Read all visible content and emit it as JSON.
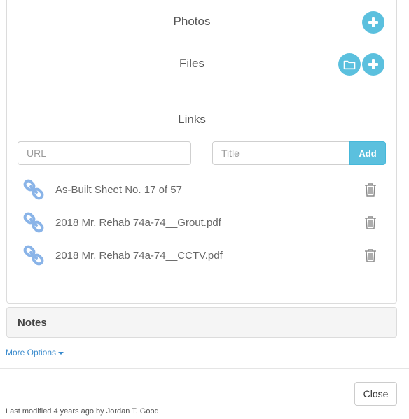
{
  "photos": {
    "title": "Photos"
  },
  "files": {
    "title": "Files"
  },
  "links": {
    "title": "Links",
    "url_placeholder": "URL",
    "title_placeholder": "Title",
    "add_label": "Add",
    "items": [
      {
        "label": "As-Built Sheet No. 17 of 57"
      },
      {
        "label": "2018 Mr. Rehab 74a-74__Grout.pdf"
      },
      {
        "label": "2018 Mr. Rehab 74a-74__CCTV.pdf"
      }
    ]
  },
  "notes": {
    "title": "Notes"
  },
  "more_options": {
    "label": "More Options"
  },
  "footer": {
    "close_label": "Close",
    "last_modified": "Last modified 4 years ago by Jordan T. Good"
  },
  "colors": {
    "accent": "#5bc0de",
    "link_icon": "#8ab4e8",
    "link_text": "#3a8bcd"
  },
  "icons": [
    "plus-icon",
    "folder-icon",
    "chain-link-icon",
    "trash-icon",
    "caret-down-icon"
  ]
}
